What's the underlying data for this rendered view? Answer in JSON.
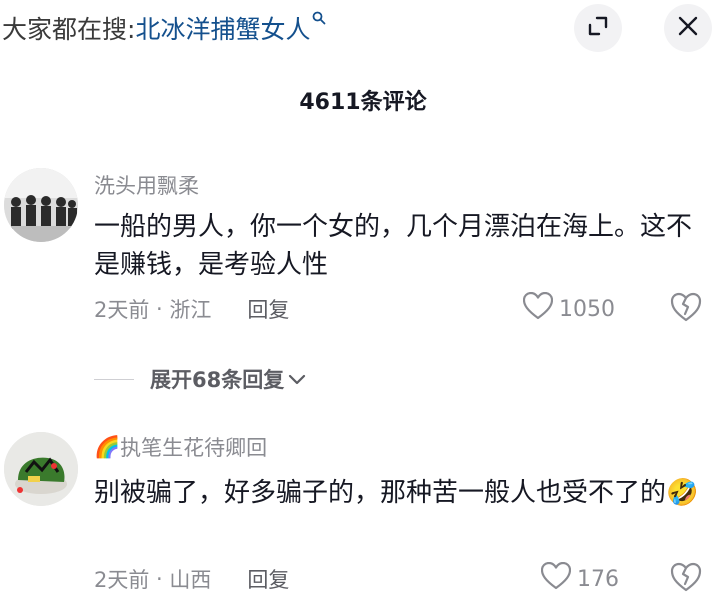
{
  "header": {
    "search_prefix": "大家都在搜:",
    "search_query": "北冰洋捕蟹女人",
    "search_icon": "search-icon",
    "expand_icon": "expand-icon",
    "close_icon": "close-icon"
  },
  "comments_title": "4611条评论",
  "comments": [
    {
      "username": "洗头用飘柔",
      "text": "一船的男人，你一个女的，几个月漂泊在海上。这不是赚钱，是考验人性",
      "time": "2天前",
      "location": "浙江",
      "reply_label": "回复",
      "likes": "1050",
      "avatar": "group-photo-avatar"
    },
    {
      "username_prefix": "🌈",
      "username": "执笔生花待卿回",
      "text": "别被骗了，好多骗子的，那种苦一般人也受不了的",
      "emoji": "🤣",
      "time": "2天前",
      "location": "山西",
      "reply_label": "回复",
      "likes": "176",
      "avatar": "cake-photo-avatar"
    }
  ],
  "expand_replies": {
    "label": "展开68条回复"
  },
  "colors": {
    "link_blue": "#14508d",
    "muted_gray": "#8a8b91",
    "text_dark": "#161823",
    "button_bg": "#f2f2f4"
  }
}
